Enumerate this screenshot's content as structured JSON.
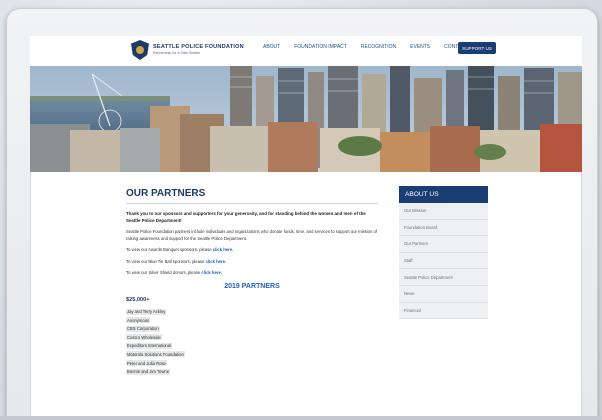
{
  "site": {
    "logo_title": "SEATTLE POLICE FOUNDATION",
    "logo_tagline": "Partnership for a Safe Seattle"
  },
  "nav": {
    "items": [
      "ABOUT",
      "FOUNDATION IMPACT",
      "RECOGNITION",
      "EVENTS",
      "CONTACT"
    ],
    "cta_label": "SUPPORT US"
  },
  "main": {
    "title": "OUR PARTNERS",
    "lead": "Thank you to our sponsors and supporters for your generosity, and for standing behind the women and men of the Seattle Police Department!",
    "intro": "Seattle Police Foundation partners include individuals and organizations who donate funds, time, and services to support our mission of raising awareness and support for the Seattle Police Department.",
    "links": [
      {
        "text": "To view our Awards Banquet sponsors, please ",
        "link": "click here."
      },
      {
        "text": "To view our Blue Tie Ball sponsors, please ",
        "link": "click here."
      },
      {
        "text": "To view our Silver Shield donors, please ",
        "link": "click here."
      }
    ],
    "section_title": "2019 PARTNERS",
    "tier_label": "$25,000+",
    "partners": [
      "Jay and Terry Ackley",
      "Anonymous",
      "CBS Corporation",
      "Costco Wholesale",
      "Expeditors International",
      "Motorola Solutions Foundation",
      "Peter and Julia Rose",
      "Bonnie and Jim Towne"
    ]
  },
  "sidebar": {
    "heading": "ABOUT US",
    "items": [
      "Our Mission",
      "Foundation Board",
      "Our Partners",
      "Staff",
      "Seattle Police Department",
      "News",
      "Financial"
    ]
  },
  "colors": {
    "brand_navy": "#1a3d73",
    "link_blue": "#1f5fbf",
    "nav_blue": "#1f4f8f"
  }
}
